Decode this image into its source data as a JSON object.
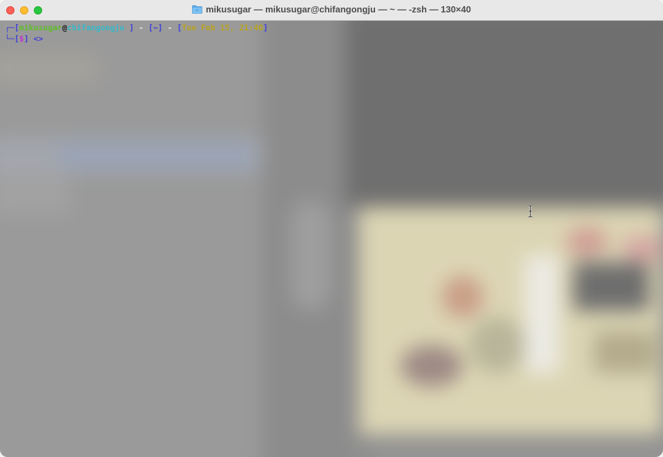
{
  "window": {
    "title": "mikusugar — mikusugar@chifangongju — ~ — -zsh — 130×40",
    "folder_icon": "folder-icon"
  },
  "prompt": {
    "line1": {
      "open_frame": "┌─[",
      "user": "mikusugar",
      "at": "@",
      "host": "chifangongju",
      "close_host": " ]",
      "sep1": " - ",
      "path_open": "[",
      "path": "~",
      "path_close": "]",
      "sep2": " - ",
      "date_open": "[",
      "date": "Tue Feb 15, 21:40",
      "date_close": "]"
    },
    "line2": {
      "open_frame": "└─[",
      "dollar": "$",
      "close_frame": "]",
      "arrow": " <>"
    }
  },
  "colors": {
    "user": "#5fbd2a",
    "host": "#37b8c9",
    "frame": "#3f3ed8",
    "date": "#b9a324",
    "dollar": "#c237c7"
  }
}
